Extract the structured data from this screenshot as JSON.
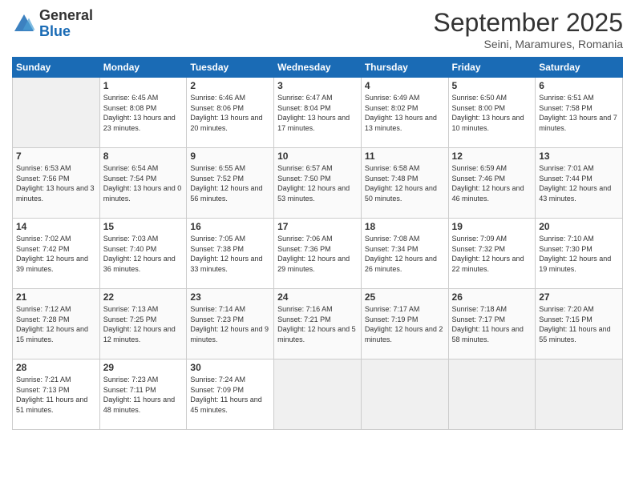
{
  "header": {
    "logo_general": "General",
    "logo_blue": "Blue",
    "month_title": "September 2025",
    "subtitle": "Seini, Maramures, Romania"
  },
  "weekdays": [
    "Sunday",
    "Monday",
    "Tuesday",
    "Wednesday",
    "Thursday",
    "Friday",
    "Saturday"
  ],
  "weeks": [
    [
      {
        "day": "",
        "sunrise": "",
        "sunset": "",
        "daylight": ""
      },
      {
        "day": "1",
        "sunrise": "Sunrise: 6:45 AM",
        "sunset": "Sunset: 8:08 PM",
        "daylight": "Daylight: 13 hours and 23 minutes."
      },
      {
        "day": "2",
        "sunrise": "Sunrise: 6:46 AM",
        "sunset": "Sunset: 8:06 PM",
        "daylight": "Daylight: 13 hours and 20 minutes."
      },
      {
        "day": "3",
        "sunrise": "Sunrise: 6:47 AM",
        "sunset": "Sunset: 8:04 PM",
        "daylight": "Daylight: 13 hours and 17 minutes."
      },
      {
        "day": "4",
        "sunrise": "Sunrise: 6:49 AM",
        "sunset": "Sunset: 8:02 PM",
        "daylight": "Daylight: 13 hours and 13 minutes."
      },
      {
        "day": "5",
        "sunrise": "Sunrise: 6:50 AM",
        "sunset": "Sunset: 8:00 PM",
        "daylight": "Daylight: 13 hours and 10 minutes."
      },
      {
        "day": "6",
        "sunrise": "Sunrise: 6:51 AM",
        "sunset": "Sunset: 7:58 PM",
        "daylight": "Daylight: 13 hours and 7 minutes."
      }
    ],
    [
      {
        "day": "7",
        "sunrise": "Sunrise: 6:53 AM",
        "sunset": "Sunset: 7:56 PM",
        "daylight": "Daylight: 13 hours and 3 minutes."
      },
      {
        "day": "8",
        "sunrise": "Sunrise: 6:54 AM",
        "sunset": "Sunset: 7:54 PM",
        "daylight": "Daylight: 13 hours and 0 minutes."
      },
      {
        "day": "9",
        "sunrise": "Sunrise: 6:55 AM",
        "sunset": "Sunset: 7:52 PM",
        "daylight": "Daylight: 12 hours and 56 minutes."
      },
      {
        "day": "10",
        "sunrise": "Sunrise: 6:57 AM",
        "sunset": "Sunset: 7:50 PM",
        "daylight": "Daylight: 12 hours and 53 minutes."
      },
      {
        "day": "11",
        "sunrise": "Sunrise: 6:58 AM",
        "sunset": "Sunset: 7:48 PM",
        "daylight": "Daylight: 12 hours and 50 minutes."
      },
      {
        "day": "12",
        "sunrise": "Sunrise: 6:59 AM",
        "sunset": "Sunset: 7:46 PM",
        "daylight": "Daylight: 12 hours and 46 minutes."
      },
      {
        "day": "13",
        "sunrise": "Sunrise: 7:01 AM",
        "sunset": "Sunset: 7:44 PM",
        "daylight": "Daylight: 12 hours and 43 minutes."
      }
    ],
    [
      {
        "day": "14",
        "sunrise": "Sunrise: 7:02 AM",
        "sunset": "Sunset: 7:42 PM",
        "daylight": "Daylight: 12 hours and 39 minutes."
      },
      {
        "day": "15",
        "sunrise": "Sunrise: 7:03 AM",
        "sunset": "Sunset: 7:40 PM",
        "daylight": "Daylight: 12 hours and 36 minutes."
      },
      {
        "day": "16",
        "sunrise": "Sunrise: 7:05 AM",
        "sunset": "Sunset: 7:38 PM",
        "daylight": "Daylight: 12 hours and 33 minutes."
      },
      {
        "day": "17",
        "sunrise": "Sunrise: 7:06 AM",
        "sunset": "Sunset: 7:36 PM",
        "daylight": "Daylight: 12 hours and 29 minutes."
      },
      {
        "day": "18",
        "sunrise": "Sunrise: 7:08 AM",
        "sunset": "Sunset: 7:34 PM",
        "daylight": "Daylight: 12 hours and 26 minutes."
      },
      {
        "day": "19",
        "sunrise": "Sunrise: 7:09 AM",
        "sunset": "Sunset: 7:32 PM",
        "daylight": "Daylight: 12 hours and 22 minutes."
      },
      {
        "day": "20",
        "sunrise": "Sunrise: 7:10 AM",
        "sunset": "Sunset: 7:30 PM",
        "daylight": "Daylight: 12 hours and 19 minutes."
      }
    ],
    [
      {
        "day": "21",
        "sunrise": "Sunrise: 7:12 AM",
        "sunset": "Sunset: 7:28 PM",
        "daylight": "Daylight: 12 hours and 15 minutes."
      },
      {
        "day": "22",
        "sunrise": "Sunrise: 7:13 AM",
        "sunset": "Sunset: 7:25 PM",
        "daylight": "Daylight: 12 hours and 12 minutes."
      },
      {
        "day": "23",
        "sunrise": "Sunrise: 7:14 AM",
        "sunset": "Sunset: 7:23 PM",
        "daylight": "Daylight: 12 hours and 9 minutes."
      },
      {
        "day": "24",
        "sunrise": "Sunrise: 7:16 AM",
        "sunset": "Sunset: 7:21 PM",
        "daylight": "Daylight: 12 hours and 5 minutes."
      },
      {
        "day": "25",
        "sunrise": "Sunrise: 7:17 AM",
        "sunset": "Sunset: 7:19 PM",
        "daylight": "Daylight: 12 hours and 2 minutes."
      },
      {
        "day": "26",
        "sunrise": "Sunrise: 7:18 AM",
        "sunset": "Sunset: 7:17 PM",
        "daylight": "Daylight: 11 hours and 58 minutes."
      },
      {
        "day": "27",
        "sunrise": "Sunrise: 7:20 AM",
        "sunset": "Sunset: 7:15 PM",
        "daylight": "Daylight: 11 hours and 55 minutes."
      }
    ],
    [
      {
        "day": "28",
        "sunrise": "Sunrise: 7:21 AM",
        "sunset": "Sunset: 7:13 PM",
        "daylight": "Daylight: 11 hours and 51 minutes."
      },
      {
        "day": "29",
        "sunrise": "Sunrise: 7:23 AM",
        "sunset": "Sunset: 7:11 PM",
        "daylight": "Daylight: 11 hours and 48 minutes."
      },
      {
        "day": "30",
        "sunrise": "Sunrise: 7:24 AM",
        "sunset": "Sunset: 7:09 PM",
        "daylight": "Daylight: 11 hours and 45 minutes."
      },
      {
        "day": "",
        "sunrise": "",
        "sunset": "",
        "daylight": ""
      },
      {
        "day": "",
        "sunrise": "",
        "sunset": "",
        "daylight": ""
      },
      {
        "day": "",
        "sunrise": "",
        "sunset": "",
        "daylight": ""
      },
      {
        "day": "",
        "sunrise": "",
        "sunset": "",
        "daylight": ""
      }
    ]
  ]
}
